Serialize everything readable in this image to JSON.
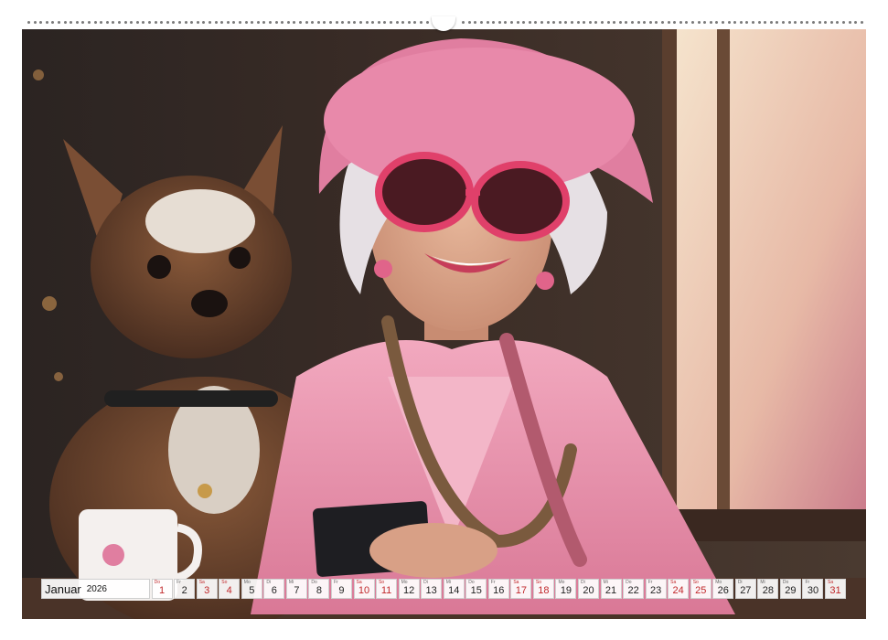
{
  "calendar": {
    "month": "Januar",
    "year": "2026",
    "days": [
      {
        "wd": "Do",
        "n": "1",
        "red": true
      },
      {
        "wd": "Fr",
        "n": "2",
        "red": false
      },
      {
        "wd": "Sa",
        "n": "3",
        "red": true
      },
      {
        "wd": "So",
        "n": "4",
        "red": true
      },
      {
        "wd": "Mo",
        "n": "5",
        "red": false
      },
      {
        "wd": "Di",
        "n": "6",
        "red": false
      },
      {
        "wd": "Mi",
        "n": "7",
        "red": false
      },
      {
        "wd": "Do",
        "n": "8",
        "red": false
      },
      {
        "wd": "Fr",
        "n": "9",
        "red": false
      },
      {
        "wd": "Sa",
        "n": "10",
        "red": true
      },
      {
        "wd": "So",
        "n": "11",
        "red": true
      },
      {
        "wd": "Mo",
        "n": "12",
        "red": false
      },
      {
        "wd": "Di",
        "n": "13",
        "red": false
      },
      {
        "wd": "Mi",
        "n": "14",
        "red": false
      },
      {
        "wd": "Do",
        "n": "15",
        "red": false
      },
      {
        "wd": "Fr",
        "n": "16",
        "red": false
      },
      {
        "wd": "Sa",
        "n": "17",
        "red": true
      },
      {
        "wd": "So",
        "n": "18",
        "red": true
      },
      {
        "wd": "Mo",
        "n": "19",
        "red": false
      },
      {
        "wd": "Di",
        "n": "20",
        "red": false
      },
      {
        "wd": "Mi",
        "n": "21",
        "red": false
      },
      {
        "wd": "Do",
        "n": "22",
        "red": false
      },
      {
        "wd": "Fr",
        "n": "23",
        "red": false
      },
      {
        "wd": "Sa",
        "n": "24",
        "red": true
      },
      {
        "wd": "So",
        "n": "25",
        "red": true
      },
      {
        "wd": "Mo",
        "n": "26",
        "red": false
      },
      {
        "wd": "Di",
        "n": "27",
        "red": false
      },
      {
        "wd": "Mi",
        "n": "28",
        "red": false
      },
      {
        "wd": "Do",
        "n": "29",
        "red": false
      },
      {
        "wd": "Fr",
        "n": "30",
        "red": false
      },
      {
        "wd": "Sa",
        "n": "31",
        "red": true
      }
    ]
  },
  "colors": {
    "accent": "#c0282b",
    "pink": "#e8829e",
    "background": "#2a1f1c"
  }
}
